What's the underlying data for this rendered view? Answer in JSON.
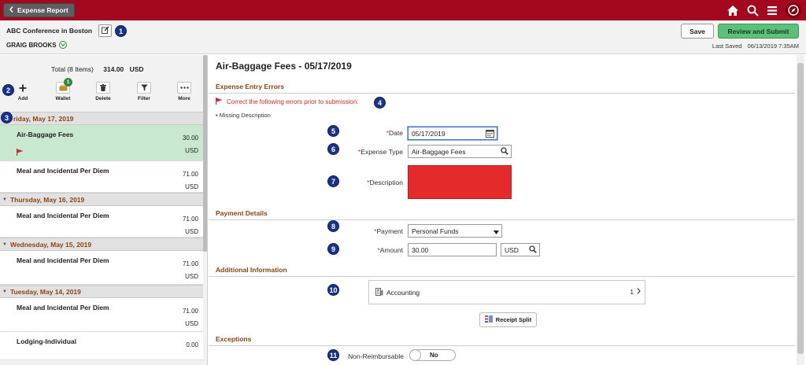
{
  "app": {
    "back_label": "Expense Report",
    "colors": {
      "topbar": "#a3081f",
      "accent_green": "#5cc07a",
      "badge_blue": "#17338c",
      "error_red": "#d22b2b"
    }
  },
  "header": {
    "report_title": "ABC Conference in Boston",
    "employee": "GRAIG BROOKS",
    "save_label": "Save",
    "submit_label": "Review and Submit",
    "last_saved_label": "Last Saved",
    "last_saved_value": "06/13/2019  7:35AM"
  },
  "left": {
    "total_label": "Total (8 Items)",
    "total_amount": "314.00",
    "total_currency": "USD",
    "toolbar": [
      {
        "label": "Add",
        "icon": "plus-icon"
      },
      {
        "label": "Wallet",
        "icon": "wallet-icon",
        "count": "1"
      },
      {
        "label": "Delete",
        "icon": "trash-icon"
      },
      {
        "label": "Filter",
        "icon": "filter-icon"
      },
      {
        "label": "More",
        "icon": "more-icon"
      }
    ],
    "groups": [
      {
        "date": "riday, May 17, 2019",
        "items": [
          {
            "name": "Air-Baggage Fees",
            "amount": "30.00",
            "currency": "USD",
            "selected": true,
            "flag": true
          },
          {
            "name": "Meal and Incidental Per Diem",
            "amount": "71.00",
            "currency": "USD"
          }
        ]
      },
      {
        "date": "Thursday, May 16, 2019",
        "items": [
          {
            "name": "Meal and Incidental Per Diem",
            "amount": "71.00",
            "currency": "USD"
          }
        ]
      },
      {
        "date": "Wednesday, May 15, 2019",
        "items": [
          {
            "name": "Meal and Incidental Per Diem",
            "amount": "71.00",
            "currency": "USD"
          }
        ]
      },
      {
        "date": "Tuesday, May 14, 2019",
        "items": [
          {
            "name": "Meal and Incidental Per Diem",
            "amount": "71.00",
            "currency": "USD"
          },
          {
            "name": "Lodging-Individual",
            "amount": "0.00",
            "currency": ""
          }
        ]
      }
    ]
  },
  "detail": {
    "title": "Air-Baggage Fees - 05/17/2019",
    "errors_section": "Expense Entry Errors",
    "error_message": "Correct the following errors prior to submission:",
    "missing": "Missing Description",
    "date_label": "Date",
    "date_value": "05/17/2019",
    "expense_type_label": "Expense Type",
    "expense_type_value": "Air-Baggage Fees",
    "description_label": "Description",
    "payment_section": "Payment Details",
    "payment_label": "Payment",
    "payment_value": "Personal Funds",
    "amount_label": "Amount",
    "amount_value": "30.00",
    "currency_value": "USD",
    "additional_section": "Additional Information",
    "accounting_label": "Accounting",
    "accounting_count": "1",
    "receipt_split_label": "Receipt Split",
    "exceptions_section": "Exceptions",
    "non_reimb_label": "Non-Reimbursable",
    "non_reimb_value": "No"
  },
  "callouts": [
    "1",
    "2",
    "3",
    "4",
    "5",
    "6",
    "7",
    "8",
    "9",
    "10",
    "11"
  ]
}
